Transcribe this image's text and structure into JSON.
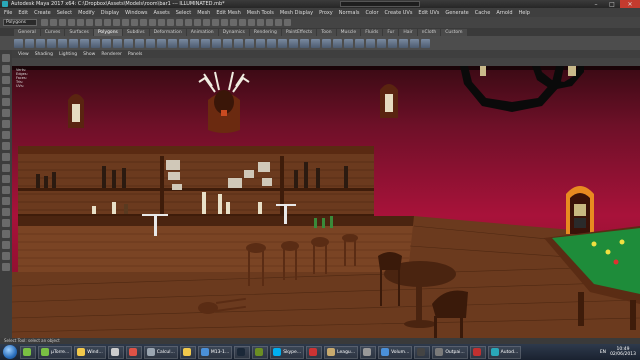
{
  "window": {
    "title": "Autodesk Maya 2017 x64: C:\\Dropbox\\Assets\\Models\\room\\bar1 --- ILLUMINATED.mb*",
    "controls": {
      "minimize": "–",
      "maximize": "□",
      "close": "✕"
    }
  },
  "menubar": {
    "items": [
      "File",
      "Edit",
      "Create",
      "Select",
      "Modify",
      "Display",
      "Windows",
      "Assets",
      "Select",
      "Mesh",
      "Edit Mesh",
      "Mesh Tools",
      "Mesh Display",
      "Proxy",
      "Normals",
      "Color",
      "Create UVs",
      "Edit UVs",
      "Generate",
      "Cache",
      "Arnold",
      "Help"
    ]
  },
  "statusline": {
    "mode": "Polygons"
  },
  "shelf": {
    "tabs": [
      "General",
      "Curves",
      "Surfaces",
      "Polygons",
      "Subdivs",
      "Deformation",
      "Animation",
      "Dynamics",
      "Rendering",
      "PaintEffects",
      "Toon",
      "Muscle",
      "Fluids",
      "Fur",
      "Hair",
      "nCloth",
      "Custom"
    ],
    "active_tab": "Polygons"
  },
  "panel_menu": {
    "items": [
      "View",
      "Shading",
      "Lighting",
      "Show",
      "Renderer",
      "Panels"
    ]
  },
  "viewport": {
    "hud_lines": [
      "Verts:",
      "Edges:",
      "Faces:",
      "Tris:",
      "UVs:"
    ]
  },
  "helpline": {
    "text": "Select Tool: select an object"
  },
  "taskbar": {
    "tasks": [
      {
        "label": "",
        "icon": "utorrent-icon",
        "color": "#7ac143"
      },
      {
        "label": "µTorre...",
        "icon": "utorrent-icon",
        "color": "#7ac143"
      },
      {
        "label": "Wind...",
        "icon": "folder-icon",
        "color": "#f2c94c"
      },
      {
        "label": "",
        "icon": "alien-icon",
        "color": "#cccccc"
      },
      {
        "label": "",
        "icon": "chrome-icon",
        "color": "#de5246"
      },
      {
        "label": "Calcul...",
        "icon": "calculator-icon",
        "color": "#9aa5b1"
      },
      {
        "label": "",
        "icon": "folder-icon",
        "color": "#f2c94c"
      },
      {
        "label": "M13-1...",
        "icon": "app-icon",
        "color": "#4a90d9"
      },
      {
        "label": "",
        "icon": "steam-icon",
        "color": "#1b2838"
      },
      {
        "label": "",
        "icon": "app-icon",
        "color": "#6b8e23"
      },
      {
        "label": "Skype...",
        "icon": "skype-icon",
        "color": "#00aff0"
      },
      {
        "label": "",
        "icon": "app-icon",
        "color": "#cc3333"
      },
      {
        "label": "Leagu...",
        "icon": "league-icon",
        "color": "#c8aa6e"
      },
      {
        "label": "",
        "icon": "app-icon",
        "color": "#999999"
      },
      {
        "label": "Volum...",
        "icon": "volume-icon",
        "color": "#4a90d9"
      },
      {
        "label": "",
        "icon": "app-icon",
        "color": "#444444"
      },
      {
        "label": "Outpai...",
        "icon": "app-icon",
        "color": "#7a7a7a"
      },
      {
        "label": "",
        "icon": "app-icon",
        "color": "#c03030"
      },
      {
        "label": "Autod...",
        "icon": "maya-icon",
        "color": "#2aa7b8"
      }
    ],
    "language": "EN",
    "time": "10:49",
    "date": "02/06/2013"
  },
  "colors": {
    "wall_top": "#3a0a14",
    "wall_mid": "#a8123a",
    "wood": "#6b3a1e",
    "felt": "#1e8c3a"
  }
}
